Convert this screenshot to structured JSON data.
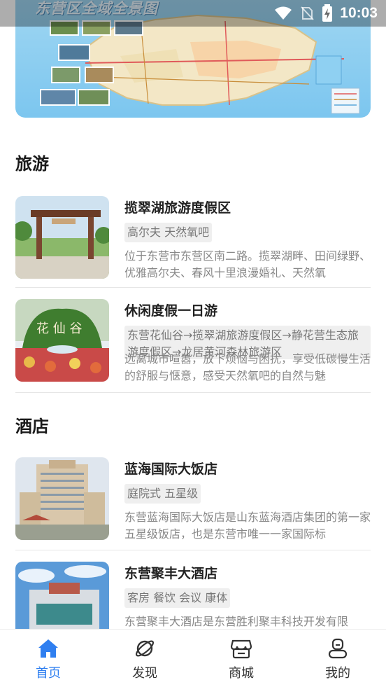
{
  "status_bar": {
    "time": "10:03"
  },
  "banner": {
    "title": "东营区全域全景图"
  },
  "sections": {
    "travel": {
      "title": "旅游"
    },
    "hotel": {
      "title": "酒店"
    }
  },
  "travel_items": [
    {
      "name": "揽翠湖旅游度假区",
      "tags": "高尔夫 天然氧吧",
      "desc": "位于东营市东营区南二路。揽翠湖畔、田间绿野、优雅高尔夫、春风十里浪漫婚礼、天然氧"
    },
    {
      "name": "休闲度假一日游",
      "tags": "东营花仙谷→揽翠湖旅游度假区→静花营生态旅游度假区→龙居黄河森林旅游区",
      "desc": "远离城市喧嚣，放下烦恼与困扰，享受低碳慢生活的舒服与惬意，感受天然氧吧的自然与魅"
    }
  ],
  "hotel_items": [
    {
      "name": "蓝海国际大饭店",
      "tags": "庭院式 五星级",
      "desc": "东营蓝海国际大饭店是山东蓝海酒店集团的第一家五星级饭店，也是东营市唯一一家国际标"
    },
    {
      "name": "东营聚丰大酒店",
      "tags": "客房 餐饮 会议 康体",
      "desc": "东营聚丰大酒店是东营胜利聚丰科技开发有限"
    }
  ],
  "bottom_nav": [
    {
      "label": "首页",
      "icon": "home-icon",
      "active": true
    },
    {
      "label": "发现",
      "icon": "planet-icon",
      "active": false
    },
    {
      "label": "商城",
      "icon": "store-icon",
      "active": false
    },
    {
      "label": "我的",
      "icon": "profile-icon",
      "active": false
    }
  ],
  "colors": {
    "accent": "#2f7ff0",
    "tag_bg": "#efefef",
    "desc_text": "#888888"
  }
}
